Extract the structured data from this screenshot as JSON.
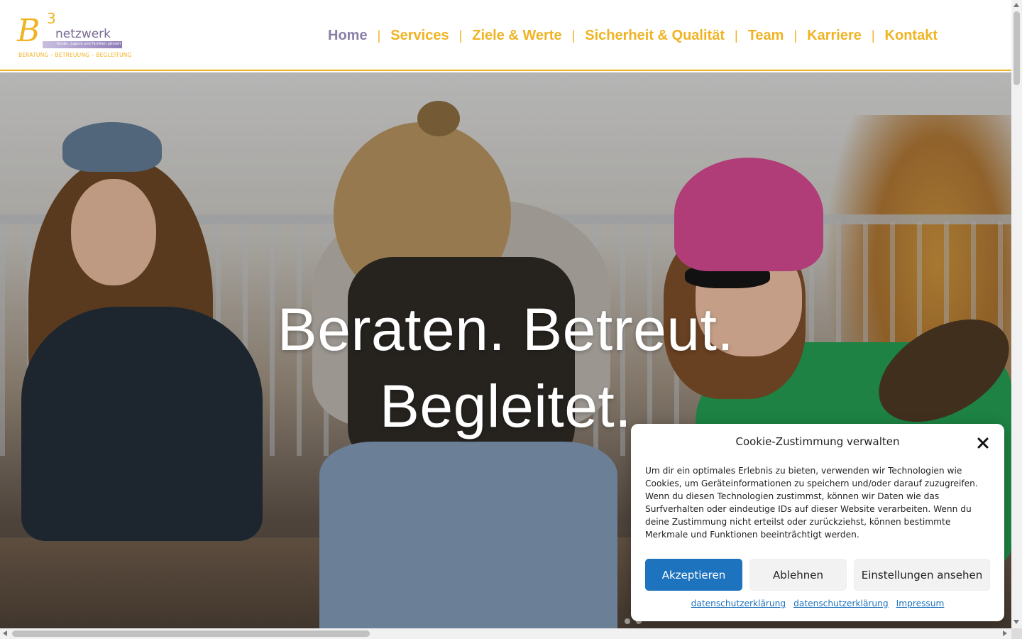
{
  "logo": {
    "letter": "B",
    "superscript": "3",
    "word": "netzwerk",
    "subline": "Kinder, Jugend und Familien gGmbH",
    "tagline": "BERATUNG – BETREUUNG – BEGLEITUNG"
  },
  "nav": {
    "items": [
      {
        "label": "Home",
        "active": true
      },
      {
        "label": "Services"
      },
      {
        "label": "Ziele & Werte"
      },
      {
        "label": "Sicherheit & Qualität"
      },
      {
        "label": "Team"
      },
      {
        "label": "Karriere"
      },
      {
        "label": "Kontakt"
      }
    ],
    "separator": "|"
  },
  "hero": {
    "line1": "Beraten. Betreut.",
    "line2": "Begleitet."
  },
  "cookie": {
    "title": "Cookie-Zustimmung verwalten",
    "body": "Um dir ein optimales Erlebnis zu bieten, verwenden wir Technologien wie Cookies, um Geräteinformationen zu speichern und/oder darauf zuzugreifen. Wenn du diesen Technologien zustimmst, können wir Daten wie das Surfverhalten oder eindeutige IDs auf dieser Website verarbeiten. Wenn du deine Zustimmung nicht erteilst oder zurückziehst, können bestimmte Merkmale und Funktionen beeinträchtigt werden.",
    "accept": "Akzeptieren",
    "deny": "Ablehnen",
    "settings": "Einstellungen ansehen",
    "link1": "datenschutzerklärung",
    "link2": "datenschutzerklärung",
    "link3": "Impressum"
  },
  "colors": {
    "accent": "#f0b323",
    "active_nav": "#8b7fa8",
    "button_primary": "#1e73be"
  },
  "icons": [
    "close-icon"
  ]
}
